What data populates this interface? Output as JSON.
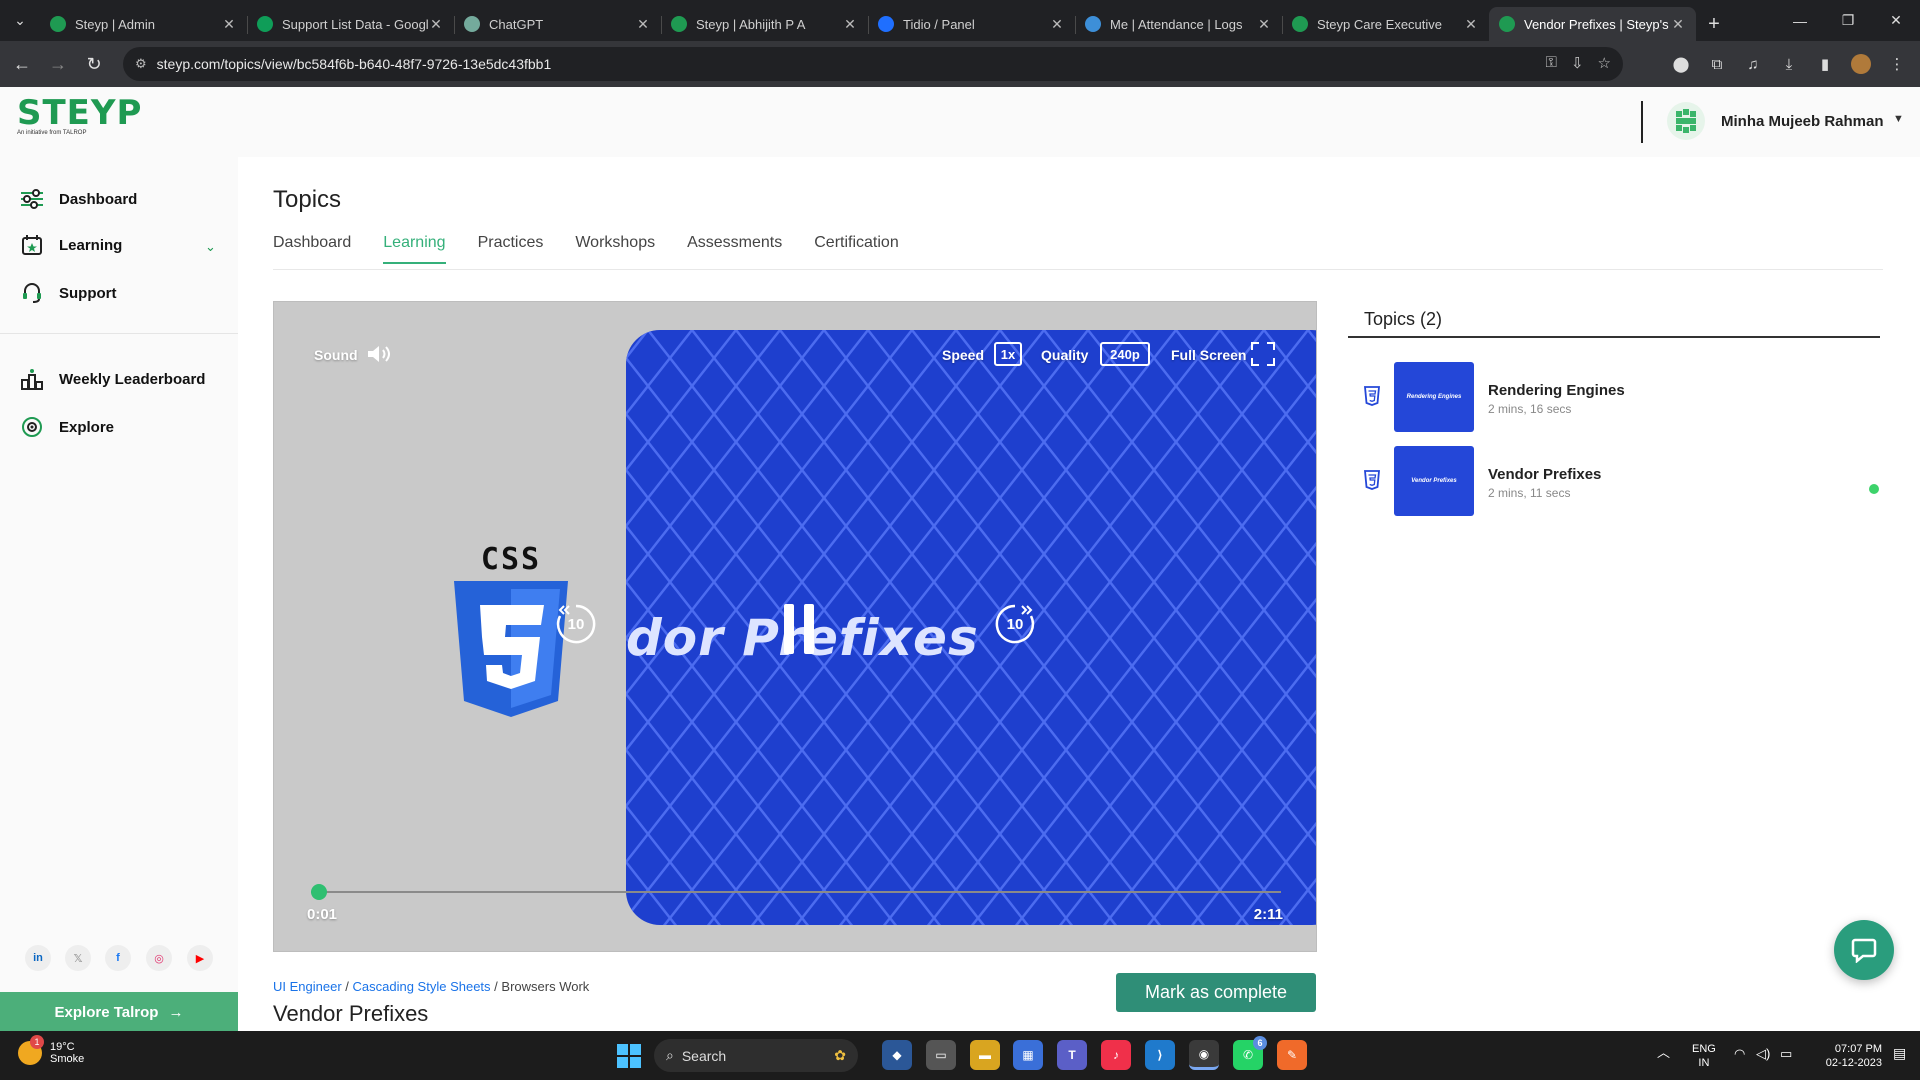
{
  "browser": {
    "tabs": [
      {
        "title": "Steyp | Admin",
        "favicon": "steyp-icon",
        "color": "#1f9a52",
        "active": false
      },
      {
        "title": "Support List Data - Googl",
        "favicon": "sheets-icon",
        "color": "#0f9d58",
        "active": false
      },
      {
        "title": "ChatGPT",
        "favicon": "chatgpt-icon",
        "color": "#74aa9c",
        "active": false
      },
      {
        "title": "Steyp | Abhijith P A",
        "favicon": "steyp-icon",
        "color": "#1f9a52",
        "active": false
      },
      {
        "title": "Tidio / Panel",
        "favicon": "tidio-icon",
        "color": "#1f6fff",
        "active": false
      },
      {
        "title": "Me | Attendance | Logs",
        "favicon": "k-icon",
        "color": "#3d8fd8",
        "active": false
      },
      {
        "title": "Steyp Care Executive",
        "favicon": "steyp-icon",
        "color": "#1f9a52",
        "active": false
      },
      {
        "title": "Vendor Prefixes | Steyp's",
        "favicon": "steyp-icon",
        "color": "#1f9a52",
        "active": true
      }
    ],
    "url": "steyp.com/topics/view/bc584f6b-b640-48f7-9726-13e5dc43fbb1"
  },
  "header": {
    "logo_text": "STEYP",
    "logo_sub": "An initiative from TALROP",
    "user_name": "Minha Mujeeb Rahman"
  },
  "sidebar": {
    "items": [
      {
        "label": "Dashboard",
        "icon": "dashboard-icon"
      },
      {
        "label": "Learning",
        "icon": "learning-icon"
      },
      {
        "label": "Support",
        "icon": "support-icon"
      },
      {
        "label": "Weekly Leaderboard",
        "icon": "leaderboard-icon"
      },
      {
        "label": "Explore",
        "icon": "explore-icon"
      }
    ],
    "explore_talrop": "Explore Talrop",
    "socials": [
      {
        "name": "linkedin-icon",
        "glyph": "in",
        "color": "#0a66c2"
      },
      {
        "name": "x-icon",
        "glyph": "𝕏",
        "color": "#999999"
      },
      {
        "name": "facebook-icon",
        "glyph": "f",
        "color": "#1877f2"
      },
      {
        "name": "instagram-icon",
        "glyph": "◎",
        "color": "#e1306c"
      },
      {
        "name": "youtube-icon",
        "glyph": "▶",
        "color": "#ff0000"
      }
    ]
  },
  "main": {
    "title": "Topics",
    "tabs": [
      "Dashboard",
      "Learning",
      "Practices",
      "Workshops",
      "Assessments",
      "Certification"
    ],
    "active_tab": "Learning",
    "player": {
      "sound_label": "Sound",
      "speed_label": "Speed",
      "speed_value": "1x",
      "quality_label": "Quality",
      "quality_value": "240p",
      "fullscreen_label": "Full Screen",
      "skip_seconds": "10",
      "current_time": "0:01",
      "total_time": "2:11",
      "progress": 0.008,
      "slide_badge": "CSS",
      "slide_text": "dor Prefixes"
    },
    "breadcrumb": [
      "UI Engineer",
      "Cascading Style Sheets",
      "Browsers Work"
    ],
    "video_title": "Vendor Prefixes",
    "mark_complete": "Mark as complete"
  },
  "topics": {
    "heading": "Topics (2)",
    "items": [
      {
        "name": "Rendering Engines",
        "duration": "2 mins, 16 secs",
        "thumb_text": "Rendering Engines",
        "active": false
      },
      {
        "name": "Vendor Prefixes",
        "duration": "2 mins, 11 secs",
        "thumb_text": "Vendor Prefixes",
        "active": true
      }
    ]
  },
  "taskbar": {
    "weather_temp": "19°C",
    "weather_desc": "Smoke",
    "weather_badge": "1",
    "search_placeholder": "Search",
    "lang": "ENG",
    "region": "IN",
    "time": "07:07 PM",
    "date": "02-12-2023",
    "whatsapp_badge": "6"
  },
  "colors": {
    "brand_green": "#1f9a52",
    "accent_teal": "#2f8e77",
    "slide_blue": "#1e3fce",
    "progress_green": "#2fbf71"
  }
}
